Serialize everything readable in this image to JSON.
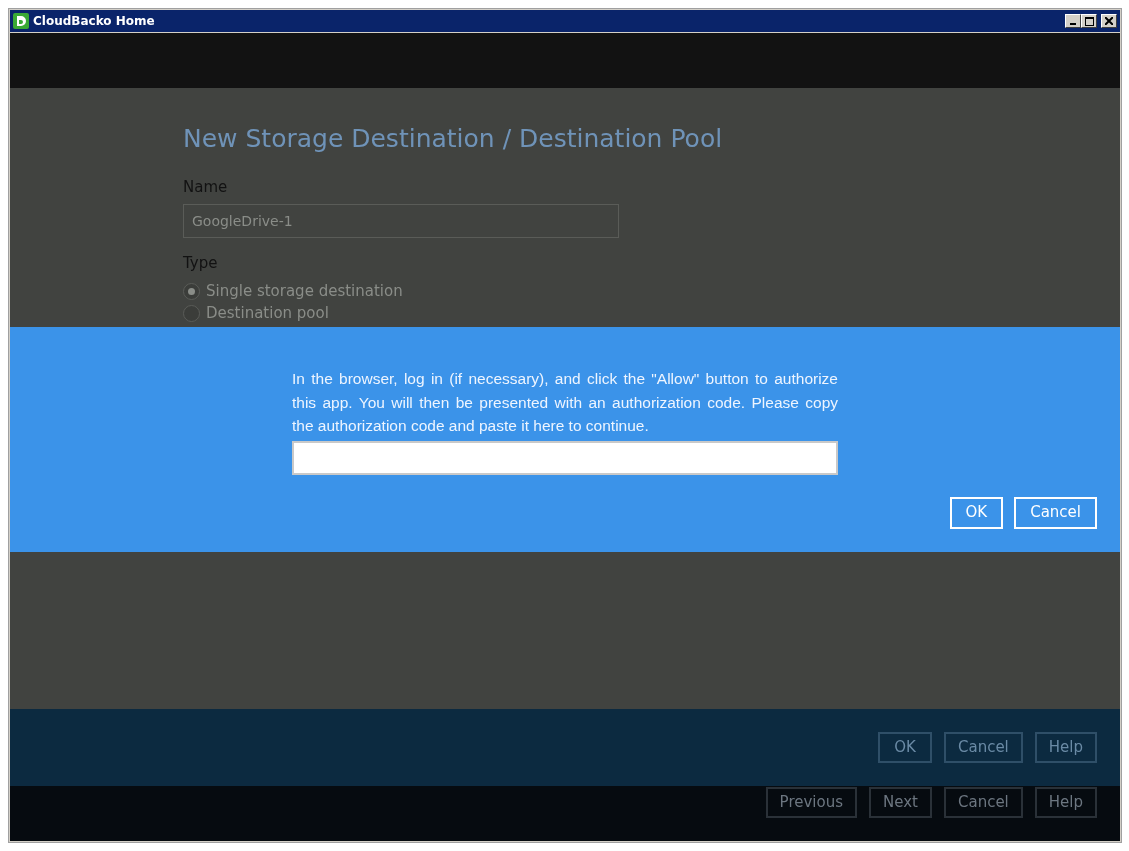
{
  "window": {
    "title": "CloudBacko Home"
  },
  "form": {
    "title": "New Storage Destination / Destination Pool",
    "name_label": "Name",
    "name_value": "GoogleDrive-1",
    "type_label": "Type",
    "type_options": [
      {
        "label": "Single storage destination",
        "selected": true
      },
      {
        "label": "Destination pool",
        "selected": false
      }
    ]
  },
  "dialog": {
    "message": "In the browser, log in (if necessary), and click the \"Allow\" button to authorize this app. You will then be presented with an authorization code. Please copy the authorization code and paste it here to continue.",
    "buttons": [
      "OK",
      "Cancel"
    ]
  },
  "footer_buttons": [
    "OK",
    "Cancel",
    "Help"
  ],
  "nav_buttons": [
    "Previous",
    "Next",
    "Cancel",
    "Help"
  ]
}
